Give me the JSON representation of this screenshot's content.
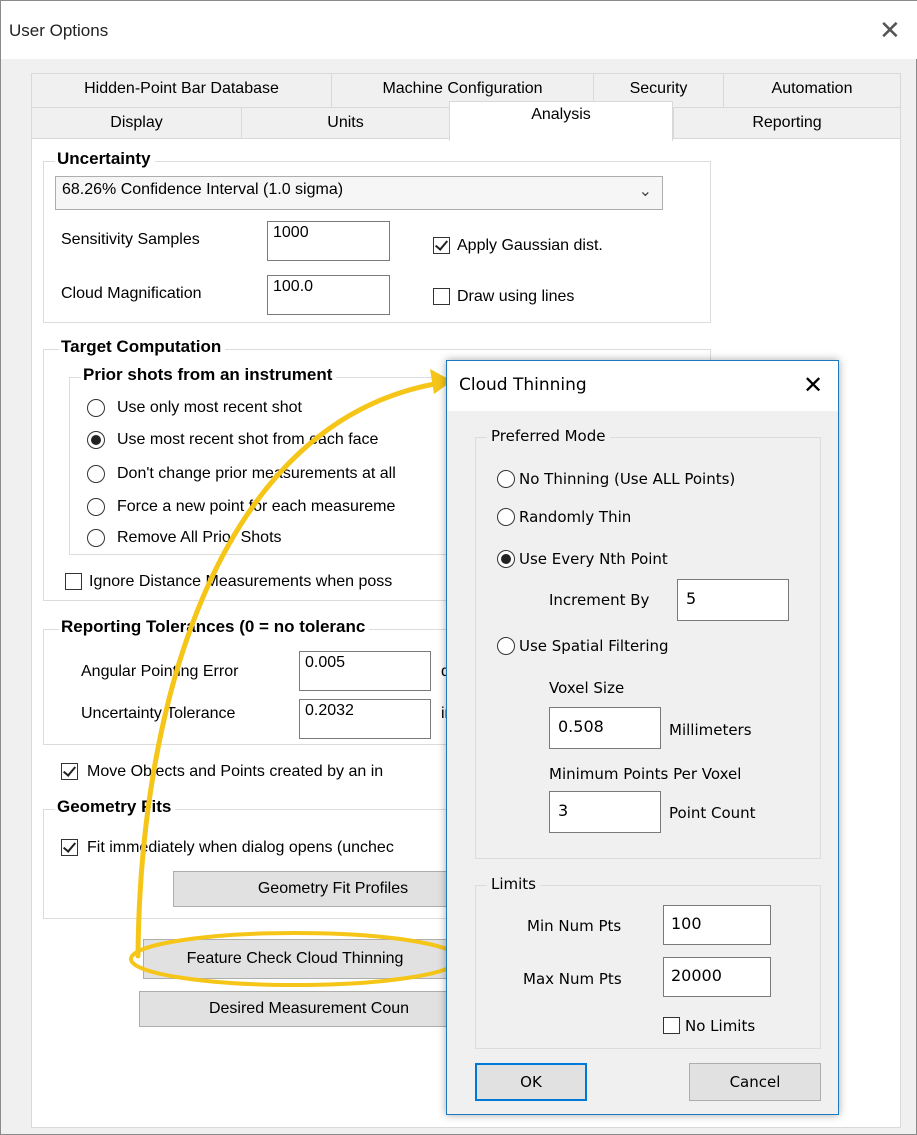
{
  "window": {
    "title": "User Options"
  },
  "tabs_row1": [
    "Hidden-Point Bar Database",
    "Machine Configuration",
    "Security",
    "Automation"
  ],
  "tabs_row2": [
    "Display",
    "Units",
    "Analysis",
    "Reporting"
  ],
  "uncertainty": {
    "group_label": "Uncertainty",
    "dropdown_value": "68.26% Confidence Interval (1.0 sigma)",
    "sensitivity_label": "Sensitivity Samples",
    "sensitivity_value": "1000",
    "magnification_label": "Cloud Magnification",
    "magnification_value": "100.0",
    "gaussian_label": "Apply Gaussian dist.",
    "gaussian_checked": true,
    "lines_label": "Draw using lines",
    "lines_checked": false
  },
  "target_computation": {
    "group_label": "Target Computation",
    "prior_label": "Prior shots from an instrument",
    "options": [
      "Use only most recent shot",
      "Use most recent shot from each face",
      "Don't change prior measurements at all",
      "Force a new point for each measureme",
      "Remove All Prior Shots"
    ],
    "selected_index": 1,
    "ignore_label": "Ignore Distance Measurements when poss"
  },
  "reporting_tolerances": {
    "group_label": "Reporting Tolerances (0 = no toleranc",
    "angular_label": "Angular Pointing Error",
    "angular_value": "0.005",
    "angular_unit": "d",
    "uncertainty_label": "Uncertainty Tolerance",
    "uncertainty_value": "0.2032",
    "uncertainty_unit": "in"
  },
  "move_objects_label": "Move Objects and Points created by an in",
  "geometry_fits": {
    "group_label": "Geometry Fits",
    "fit_label": "Fit immediately when dialog opens (unchec",
    "profiles_button": "Geometry Fit Profiles"
  },
  "feature_check_button": "Feature Check Cloud Thinning",
  "desired_count_button": "Desired Measurement Coun",
  "cloud_thinning": {
    "title": "Cloud Thinning",
    "preferred_mode_label": "Preferred Mode",
    "modes": [
      "No Thinning (Use ALL Points)",
      "Randomly Thin",
      "Use Every Nth Point",
      "Use Spatial Filtering"
    ],
    "selected_mode": 2,
    "increment_label": "Increment By",
    "increment_value": "5",
    "voxel_size_label": "Voxel Size",
    "voxel_size_value": "0.508",
    "voxel_unit": "Millimeters",
    "min_points_label": "Minimum Points Per Voxel",
    "min_points_value": "3",
    "min_points_unit": "Point Count",
    "limits_label": "Limits",
    "min_num_label": "Min Num Pts",
    "min_num_value": "100",
    "max_num_label": "Max Num Pts",
    "max_num_value": "20000",
    "no_limits_label": "No Limits",
    "no_limits_checked": false,
    "ok_label": "OK",
    "cancel_label": "Cancel"
  },
  "colors": {
    "highlight": "#f5c518",
    "accent": "#0078d7"
  }
}
